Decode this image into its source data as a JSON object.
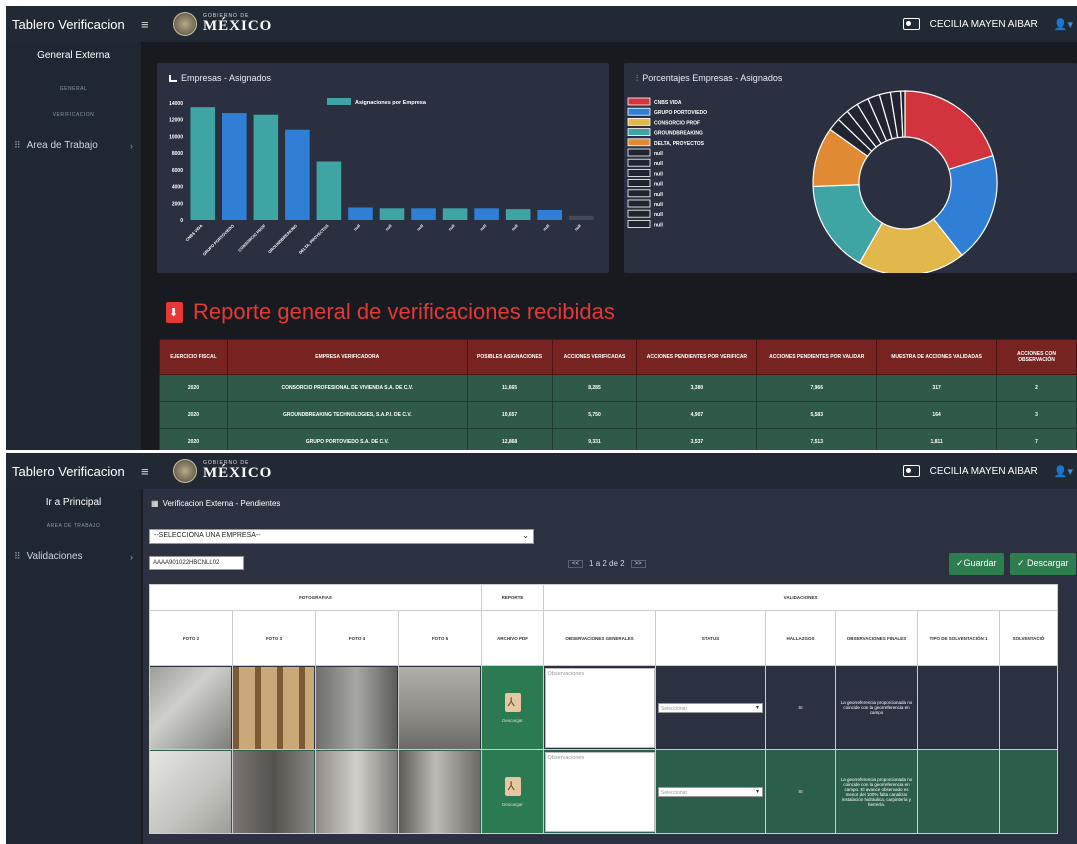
{
  "top": {
    "brand": "Tablero Verificacion",
    "gov_small": "GOBIERNO DE",
    "gov_big": "MÉXICO",
    "user": "CECILIA MAYEN AIBAR",
    "sidebar": {
      "title": "General Externa",
      "sub1": "GENERAL",
      "sub2": "VERIFICACION",
      "item": "Area de Trabajo"
    },
    "bar_card_title": "Empresas - Asignados",
    "pie_card_title": "Porcentajes Empresas - Asignados",
    "report_title": "Reporte general de verificaciones recibidas",
    "report_headers": [
      "EJERCICIO FISCAL",
      "EMPRESA VERIFICADORA",
      "POSIBLES ASIGNACIONES",
      "ACCIONES VERIFICADAS",
      "ACCIONES PENDIENTES POR VERIFICAR",
      "ACCIONES PENDIENTES POR VALIDAR",
      "MUESTRA DE ACCIONES VALIDADAS",
      "ACCIONES CON OBSERVACIÓN"
    ],
    "report_rows": [
      [
        "2020",
        "CONSORCIO PROFESIONAL DE VIVIENDA S.A. DE C.V.",
        "11,665",
        "8,285",
        "3,380",
        "7,966",
        "317",
        "2"
      ],
      [
        "2020",
        "GROUNDBREAKING TECHNOLOGIES, S.A.P.I. DE C.V.",
        "10,657",
        "5,750",
        "4,907",
        "5,583",
        "164",
        "3"
      ],
      [
        "2020",
        "GRUPO PORTOVIEDO S.A. DE C.V.",
        "12,868",
        "9,331",
        "3,537",
        "7,513",
        "1,811",
        "7"
      ]
    ]
  },
  "bottom": {
    "brand": "Tablero Verificacion",
    "gov_small": "GOBIERNO DE",
    "gov_big": "MÉXICO",
    "user": "CECILIA MAYEN AIBAR",
    "sidebar": {
      "title": "Ir a Principal",
      "sub1": "AREA DE TRABAJO",
      "item": "Validaciones"
    },
    "panel_title": "Verificacion Externa - Pendientes",
    "select_value": "--SELECCIONA UNA EMPRESA--",
    "search_value": "AAAA901022HBCNLL02",
    "pager": {
      "prev": "<<",
      "text": "1 a 2 de 2",
      "next": ">>"
    },
    "save_label": "✓Guardar",
    "download_label": "✓ Descargar",
    "group_headers": {
      "fotos": "FOTOGRAFIAS",
      "reporte": "REPORTE",
      "validaciones": "VALIDACIONES"
    },
    "col_headers": [
      "FOTO 2",
      "FOTO 3",
      "FOTO 4",
      "FOTO 5",
      "ARCHIVO PDF",
      "OBSERVACIONES GENERALES",
      "STATUS",
      "HALLAZGOS",
      "OBSERVACIONES FINALES",
      "TIPO DE SOLVENTACIÓN 1",
      "SOLVENTACIÓ"
    ],
    "rows": [
      {
        "pdf_label": "Descargar",
        "obs_placeholder": "Observaciones",
        "status": "Seleccionar",
        "hallazgos": "SI",
        "obs_final": "La georreferencia proporcionada no coincide con la georreferencia en campo"
      },
      {
        "pdf_label": "Descargar",
        "obs_placeholder": "Observaciones",
        "status": "Seleccionar",
        "hallazgos": "SI",
        "obs_final": "La georreferencia proporcionada no coincide con la georreferencia en campo. El avance observado es menor del 100% falta canalizar instalación hidráulica, carpintería y herrería."
      }
    ]
  },
  "chart_data": [
    {
      "type": "bar",
      "title": "Empresas - Asignados",
      "legend": "Asignaciones por Empresa",
      "categories": [
        "CNBS VIDA",
        "GRUPO PORTOVIEDO",
        "CONSORCIO PROF",
        "GROUNDBREAKING",
        "DELTA, PROYECTOS",
        "null",
        "null",
        "null",
        "null",
        "null",
        "null",
        "null",
        "null"
      ],
      "values": [
        13500,
        12800,
        12600,
        10800,
        7000,
        1500,
        1400,
        1400,
        1400,
        1400,
        1300,
        1200,
        500
      ],
      "ylim": [
        0,
        14000
      ],
      "yticks": [
        0,
        2000,
        4000,
        6000,
        8000,
        10000,
        12000,
        14000
      ],
      "colors": [
        "#3fa4a4",
        "#2f7fd6",
        "#3fa4a4",
        "#2f7fd6",
        "#3fa4a4",
        "#2f7fd6",
        "#3fa4a4",
        "#2f7fd6",
        "#3fa4a4",
        "#2f7fd6",
        "#3fa4a4",
        "#2f7fd6",
        "#444a56"
      ]
    },
    {
      "type": "pie",
      "title": "Porcentajes Empresas - Asignados",
      "labels": [
        "CNBS VIDA",
        "GRUPO PORTOVIEDO",
        "CONSORCIO PROF",
        "GROUNDBREAKING",
        "DELTA, PROYECTOS",
        "null",
        "null",
        "null",
        "null",
        "null",
        "null",
        "null",
        "null"
      ],
      "values": [
        13500,
        12800,
        12600,
        10800,
        7000,
        1500,
        1400,
        1400,
        1400,
        1400,
        1300,
        1200,
        500
      ],
      "colors": [
        "#d1343d",
        "#2f7fd6",
        "#e2b84a",
        "#3fa4a4",
        "#e08a34",
        "#1f2430",
        "#1f2430",
        "#1f2430",
        "#1f2430",
        "#1f2430",
        "#1f2430",
        "#1f2430",
        "#1f2430"
      ]
    }
  ]
}
